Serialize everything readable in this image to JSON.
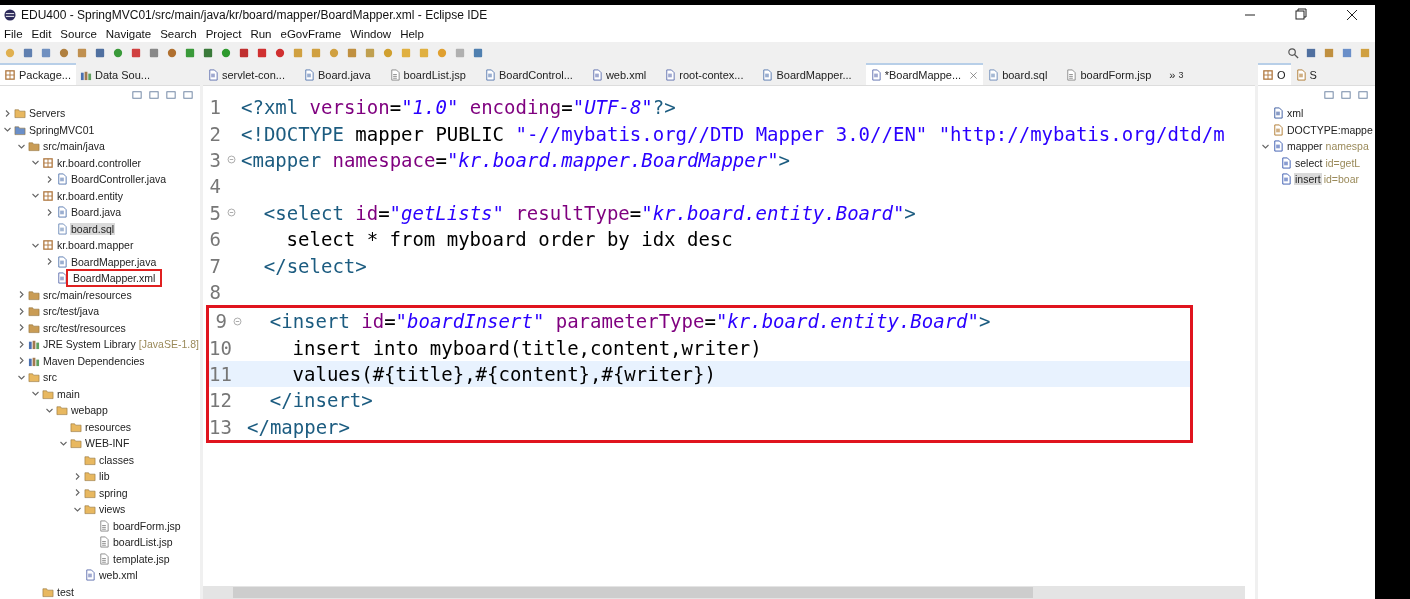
{
  "window": {
    "title": "EDU400 - SpringMVC01/src/main/java/kr/board/mapper/BoardMapper.xml - Eclipse IDE"
  },
  "menu": [
    "File",
    "Edit",
    "Source",
    "Navigate",
    "Search",
    "Project",
    "Run",
    "eGovFrame",
    "Window",
    "Help"
  ],
  "left_tabs": [
    {
      "label": "Package...",
      "selected": true
    },
    {
      "label": "Data Sou...",
      "selected": false
    }
  ],
  "tree": [
    {
      "label": "Servers",
      "kind": "folder",
      "expanded": false
    },
    {
      "label": "SpringMVC01",
      "kind": "project",
      "expanded": true,
      "children": [
        {
          "label": "src/main/java",
          "kind": "srcfolder",
          "expanded": true,
          "children": [
            {
              "label": "kr.board.controller",
              "kind": "package",
              "expanded": true,
              "children": [
                {
                  "label": "BoardController.java",
                  "kind": "java",
                  "expanded": false
                }
              ]
            },
            {
              "label": "kr.board.entity",
              "kind": "package",
              "expanded": true,
              "children": [
                {
                  "label": "Board.java",
                  "kind": "java",
                  "expanded": false
                },
                {
                  "label": "board.sql",
                  "kind": "sql",
                  "selected": true
                }
              ]
            },
            {
              "label": "kr.board.mapper",
              "kind": "package",
              "expanded": true,
              "children": [
                {
                  "label": "BoardMapper.java",
                  "kind": "java",
                  "expanded": false
                },
                {
                  "label": "BoardMapper.xml",
                  "kind": "xml",
                  "boxed": true
                }
              ]
            }
          ]
        },
        {
          "label": "src/main/resources",
          "kind": "srcfolder",
          "expanded": false
        },
        {
          "label": "src/test/java",
          "kind": "srcfolder",
          "expanded": false
        },
        {
          "label": "src/test/resources",
          "kind": "srcfolder",
          "expanded": false
        },
        {
          "label": "JRE System Library",
          "detail": "[JavaSE-1.8]",
          "kind": "library",
          "expanded": false
        },
        {
          "label": "Maven Dependencies",
          "kind": "library",
          "expanded": false
        },
        {
          "label": "src",
          "kind": "folder",
          "expanded": true,
          "children": [
            {
              "label": "main",
              "kind": "folder",
              "expanded": true,
              "children": [
                {
                  "label": "webapp",
                  "kind": "folder",
                  "expanded": true,
                  "children": [
                    {
                      "label": "resources",
                      "kind": "folder"
                    },
                    {
                      "label": "WEB-INF",
                      "kind": "folder",
                      "expanded": true,
                      "children": [
                        {
                          "label": "classes",
                          "kind": "folder"
                        },
                        {
                          "label": "lib",
                          "kind": "folder",
                          "expanded": false
                        },
                        {
                          "label": "spring",
                          "kind": "folder",
                          "expanded": false
                        },
                        {
                          "label": "views",
                          "kind": "folder",
                          "expanded": true,
                          "children": [
                            {
                              "label": "boardForm.jsp",
                              "kind": "jsp"
                            },
                            {
                              "label": "boardList.jsp",
                              "kind": "jsp"
                            },
                            {
                              "label": "template.jsp",
                              "kind": "jsp"
                            }
                          ]
                        },
                        {
                          "label": "web.xml",
                          "kind": "xml"
                        }
                      ]
                    }
                  ]
                }
              ]
            },
            {
              "label": "test",
              "kind": "folder"
            }
          ]
        }
      ]
    }
  ],
  "editor_tabs": [
    {
      "label": "servlet-con...",
      "kind": "xml",
      "selected": false
    },
    {
      "label": "Board.java",
      "kind": "java",
      "selected": false
    },
    {
      "label": "boardList.jsp",
      "kind": "jsp",
      "selected": false
    },
    {
      "label": "BoardControl...",
      "kind": "java",
      "selected": false
    },
    {
      "label": "web.xml",
      "kind": "xml",
      "selected": false
    },
    {
      "label": "root-contex...",
      "kind": "xml",
      "selected": false
    },
    {
      "label": "BoardMapper...",
      "kind": "java",
      "selected": false
    },
    {
      "label": "*BoardMappe...",
      "kind": "xml",
      "selected": true
    },
    {
      "label": "board.sql",
      "kind": "sql",
      "selected": false
    },
    {
      "label": "boardForm.jsp",
      "kind": "jsp",
      "selected": false
    }
  ],
  "more_tabs": {
    "symbol": "»",
    "count": "3"
  },
  "code": [
    {
      "number": "1",
      "tokens": [
        {
          "kind": "tag",
          "text": "<?xml"
        },
        {
          "kind": "attr",
          "text": "version"
        },
        {
          "kind": "plain",
          "text": "="
        },
        {
          "kind": "value",
          "text": "\"1.0\""
        },
        {
          "kind": "attr",
          "text": "encoding"
        },
        {
          "kind": "plain",
          "text": "="
        },
        {
          "kind": "value",
          "text": "\"UTF-8\""
        },
        {
          "kind": "tag",
          "text": "?>"
        }
      ]
    },
    {
      "number": "2",
      "tokens": [
        {
          "kind": "tag",
          "text": "<!DOCTYPE"
        },
        {
          "kind": "plain",
          "text": "mapper PUBLIC"
        },
        {
          "kind": "string",
          "text": "\"-//mybatis.org//DTD Mapper 3.0//EN\""
        },
        {
          "kind": "string",
          "text": "\"http://mybatis.org/dtd/m"
        }
      ]
    },
    {
      "number": "3",
      "fold": true,
      "tokens": [
        {
          "kind": "tag",
          "text": "<mapper"
        },
        {
          "kind": "attr",
          "text": "namespace"
        },
        {
          "kind": "plain",
          "text": "="
        },
        {
          "kind": "value",
          "text": "\"kr.board.mapper.BoardMapper\""
        },
        {
          "kind": "tag",
          "text": ">"
        }
      ]
    },
    {
      "number": "4"
    },
    {
      "number": "5",
      "fold": true,
      "tokens": [
        {
          "kind": "tag",
          "text": "<select"
        },
        {
          "kind": "attr",
          "text": "id"
        },
        {
          "kind": "plain",
          "text": "="
        },
        {
          "kind": "value",
          "text": "\"getLists\""
        },
        {
          "kind": "attr",
          "text": "resultType"
        },
        {
          "kind": "plain",
          "text": "="
        },
        {
          "kind": "value",
          "text": "\"kr.board.entity.Board\""
        },
        {
          "kind": "tag",
          "text": ">"
        }
      ]
    },
    {
      "number": "6",
      "tokens": [
        {
          "kind": "plain",
          "text": "select * from myboard order by idx desc"
        }
      ]
    },
    {
      "number": "7",
      "tokens": [
        {
          "kind": "tag",
          "text": "</select>"
        }
      ]
    },
    {
      "number": "8"
    },
    {
      "number": "9",
      "fold": true,
      "boxed": true,
      "tokens": [
        {
          "kind": "tag",
          "text": "<insert"
        },
        {
          "kind": "attr",
          "text": "id"
        },
        {
          "kind": "plain",
          "text": "="
        },
        {
          "kind": "value",
          "text": "\"boardInsert\""
        },
        {
          "kind": "attr",
          "text": "parameterType"
        },
        {
          "kind": "plain",
          "text": "="
        },
        {
          "kind": "value",
          "text": "\"kr.board.entity.Board\""
        },
        {
          "kind": "tag",
          "text": ">"
        }
      ]
    },
    {
      "number": "10",
      "boxed": true,
      "tokens": [
        {
          "kind": "plain",
          "text": "insert into myboard(title,content,writer)"
        }
      ]
    },
    {
      "number": "11",
      "boxed": true,
      "current": true,
      "tokens": [
        {
          "kind": "plain",
          "text": "values(#{title},#{content},#{writer})"
        }
      ]
    },
    {
      "number": "12",
      "boxed": true,
      "tokens": [
        {
          "kind": "tag",
          "text": "</insert>"
        }
      ]
    },
    {
      "number": "13",
      "boxed": true,
      "tokens": [
        {
          "kind": "tag",
          "text": "</mapper>"
        }
      ]
    }
  ],
  "right_tabs": [
    {
      "label": "O",
      "selected": true
    },
    {
      "label": "S",
      "selected": false
    }
  ],
  "outline": [
    {
      "label": "xml",
      "kind": "pi"
    },
    {
      "label": "DOCTYPE:mappe",
      "kind": "doctype"
    },
    {
      "label": "mapper",
      "detail": "namespa",
      "kind": "element",
      "expanded": true,
      "children": [
        {
          "label": "select",
          "detail": "id=getL",
          "kind": "element",
          "selected": false
        },
        {
          "label": "insert",
          "detail": "id=boar",
          "kind": "element",
          "selected": true
        }
      ]
    }
  ]
}
